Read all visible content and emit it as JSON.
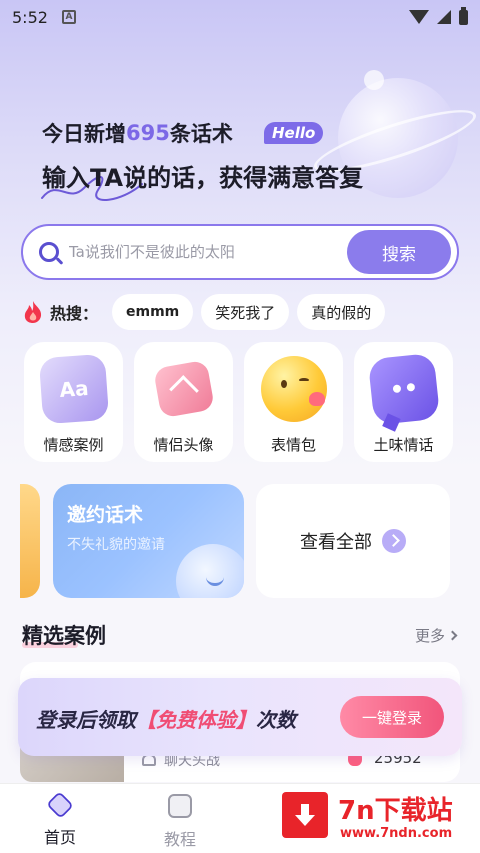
{
  "status_bar": {
    "time": "5:52",
    "notification_badge": "A"
  },
  "header": {
    "line1_prefix": "今日新增",
    "new_count": "695",
    "line1_suffix": "条话术",
    "hello_badge": "Hello",
    "line2": "输入TA说的话，获得满意答复"
  },
  "search": {
    "placeholder": "Ta说我们不是彼此的太阳",
    "button_label": "搜索"
  },
  "hot_search": {
    "label": "热搜：",
    "chips": [
      "emmm",
      "笑死我了",
      "真的假的"
    ]
  },
  "categories": [
    {
      "label": "情感案例",
      "icon": "aa-card-icon"
    },
    {
      "label": "情侣头像",
      "icon": "heart-icon"
    },
    {
      "label": "表情包",
      "icon": "emoji-kiss-icon"
    },
    {
      "label": "土味情话",
      "icon": "chat-bubble-icon"
    }
  ],
  "banner": {
    "title": "邀约话术",
    "subtitle": "不失礼貌的邀请",
    "view_all_label": "查看全部"
  },
  "featured": {
    "title": "精选案例",
    "more_label": "更多",
    "case_tag": "聊天头战",
    "case_count": "25952"
  },
  "login_banner": {
    "text_prefix": "登录后领取",
    "text_highlight": "【免费体验】",
    "text_suffix": "次数",
    "button_label": "一键登录"
  },
  "bottom_nav": {
    "home_label": "首页",
    "tutorial_label": "教程"
  },
  "watermark": {
    "brand": "7n下载站",
    "url": "www.7ndn.com"
  },
  "colors": {
    "accent": "#8b7cec",
    "highlight": "#f04d74",
    "watermark": "#e8242a"
  }
}
